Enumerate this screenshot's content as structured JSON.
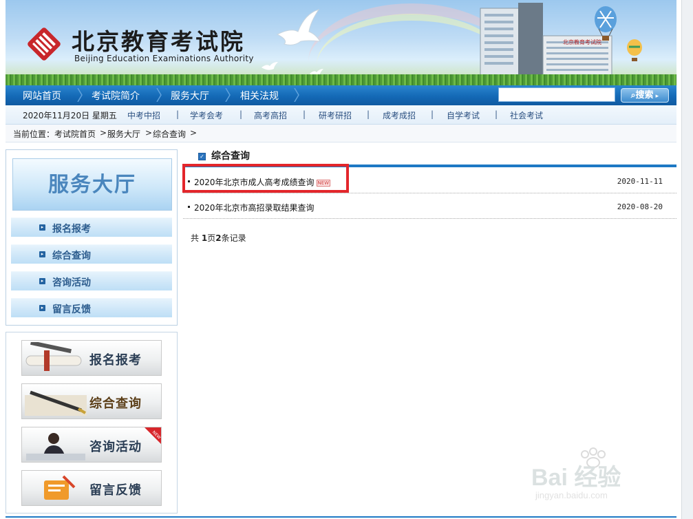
{
  "header": {
    "logo_cn": "北京教育考试院",
    "logo_en": "Beijing Education Examinations Authority"
  },
  "main_nav": {
    "items": [
      "网站首页",
      "考试院简介",
      "服务大厅",
      "相关法规"
    ],
    "search_placeholder": "",
    "search_button": "搜索"
  },
  "sub_nav": {
    "date": "2020年11月20日  星期五",
    "links": [
      "中考中招",
      "学考会考",
      "高考高招",
      "研考研招",
      "成考成招",
      "自学考试",
      "社会考试"
    ],
    "separator": "|"
  },
  "breadcrumb": {
    "prefix": "当前位置：",
    "items": [
      "考试院首页",
      "服务大厅",
      "综合查询"
    ],
    "separator": ">"
  },
  "sidebar": {
    "title": "服务大厅",
    "items": [
      "报名报考",
      "综合查询",
      "咨询活动",
      "留言反馈"
    ],
    "image_buttons": [
      "报名报考",
      "综合查询",
      "咨询活动",
      "留言反馈"
    ],
    "new_badge": "NEW"
  },
  "content": {
    "section_title": "综合查询",
    "rows": [
      {
        "title": "2020年北京市成人高考成绩查询",
        "date": "2020-11-11",
        "is_new": true,
        "new_label": "NEW"
      },
      {
        "title": "2020年北京市高招录取结果查询",
        "date": "2020-08-20",
        "is_new": false
      }
    ],
    "pager": {
      "prefix": "共 ",
      "pages": "1",
      "mid": "页",
      "count": "2",
      "suffix": "条记录"
    }
  },
  "watermark": {
    "brand": "Bai 经验",
    "url": "jingyan.baidu.com"
  },
  "colors": {
    "nav_blue": "#1469b6",
    "accent_blue": "#1d79c4",
    "highlight_red": "#e3262b",
    "sidebar_text": "#2d5d8e"
  }
}
